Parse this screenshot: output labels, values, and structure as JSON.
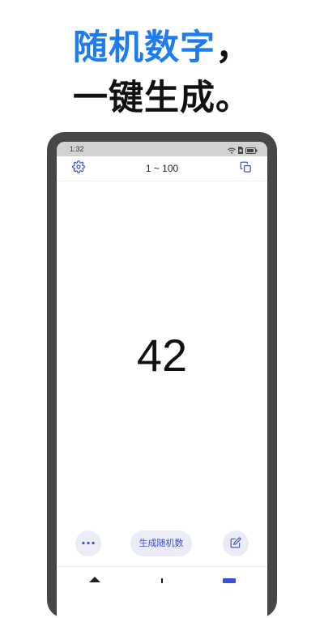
{
  "headline": {
    "line1_highlight": "随机数字",
    "line1_punct": "，",
    "line2": "一键生成。"
  },
  "status_bar": {
    "time": "1:32"
  },
  "top_bar": {
    "range_label": "1 ~ 100"
  },
  "result": {
    "number": "42"
  },
  "controls": {
    "more_label": "···",
    "generate_label": "生成随机数"
  },
  "colors": {
    "accent_blue": "#1E7BF0",
    "control_blue": "#3C4FD6",
    "control_bg": "#ECECF6",
    "phone_frame": "#474747",
    "status_bar_bg": "#D2D2D2"
  },
  "icons": {
    "settings": "gear-icon",
    "copy": "copy-icon",
    "edit": "edit-icon",
    "more": "more-icon",
    "wifi": "wifi-icon",
    "sim": "sim-icon",
    "battery": "battery-icon"
  }
}
